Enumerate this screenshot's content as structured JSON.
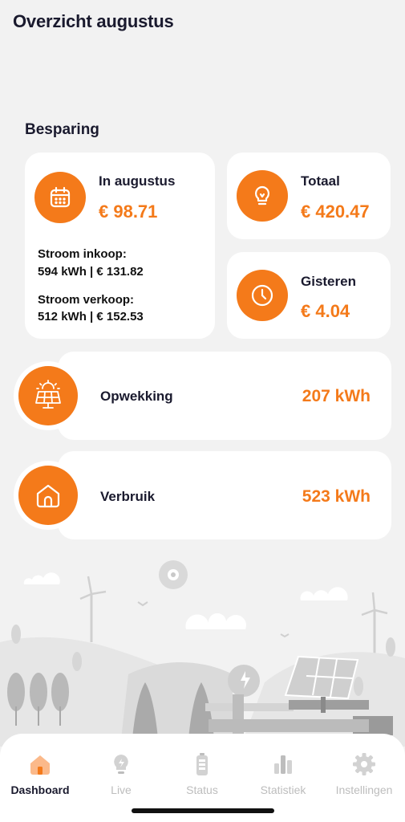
{
  "header": {
    "title": "Overzicht augustus"
  },
  "savings": {
    "section_title": "Besparing",
    "month": {
      "label": "In augustus",
      "value": "€ 98.71",
      "purchase_title": "Stroom inkoop:",
      "purchase_value": "594 kWh | € 131.82",
      "sale_title": "Stroom verkoop:",
      "sale_value": "512 kWh | € 152.53"
    },
    "total": {
      "label": "Totaal",
      "value": "€ 420.47"
    },
    "yesterday": {
      "label": "Gisteren",
      "value": "€ 4.04"
    }
  },
  "generation": {
    "label": "Opwekking",
    "value": "207 kWh"
  },
  "consumption": {
    "label": "Verbruik",
    "value": "523 kWh"
  },
  "tabs": [
    {
      "label": "Dashboard",
      "icon": "house-icon",
      "active": true
    },
    {
      "label": "Live",
      "icon": "lightbulb-icon",
      "active": false
    },
    {
      "label": "Status",
      "icon": "battery-icon",
      "active": false
    },
    {
      "label": "Statistiek",
      "icon": "bar-chart-icon",
      "active": false
    },
    {
      "label": "Instellingen",
      "icon": "gear-icon",
      "active": false
    }
  ],
  "colors": {
    "accent": "#f47a1a",
    "text_dark": "#1a1a2e",
    "tab_inactive": "#bdbdbd"
  }
}
